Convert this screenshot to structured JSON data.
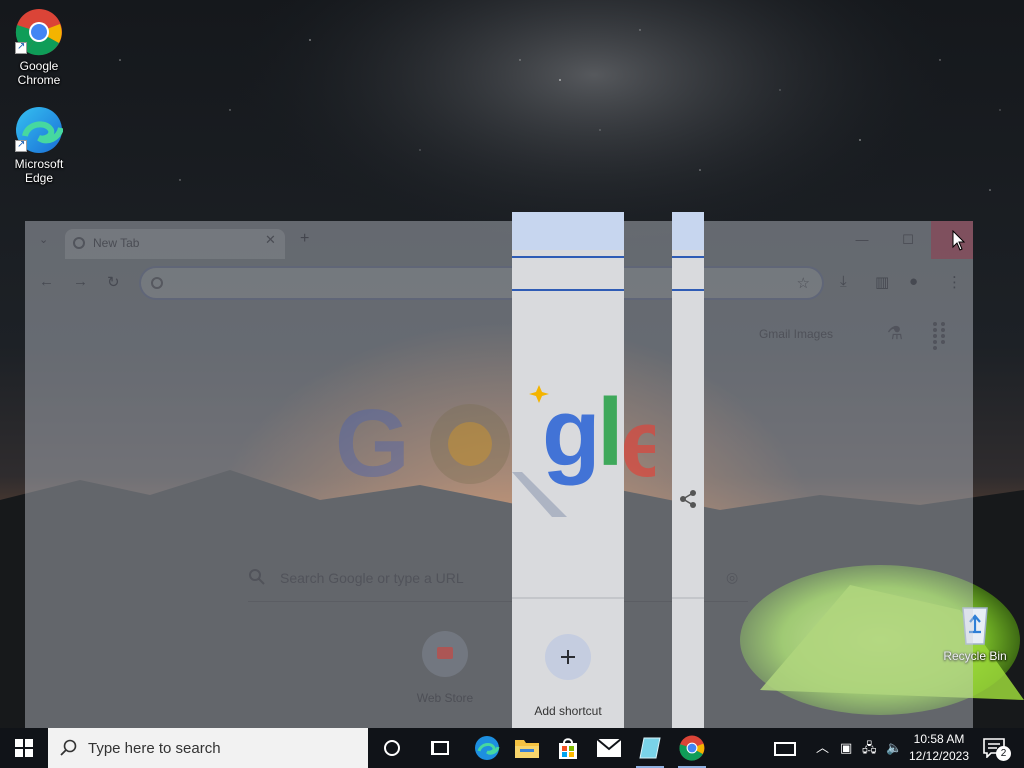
{
  "desktop": {
    "icons": [
      {
        "label_line1": "Google",
        "label_line2": "Chrome",
        "icon": "chrome-icon"
      },
      {
        "label_line1": "Microsoft",
        "label_line2": "Edge",
        "icon": "edge-icon"
      },
      {
        "label": "Recycle Bin",
        "icon": "recycle-bin-icon"
      }
    ]
  },
  "chrome": {
    "tab_title": "New Tab",
    "tab_close": "✕",
    "new_tab": "+",
    "minimize": "—",
    "maximize": "☐",
    "ntp_links": "Gmail  Images",
    "search_placeholder": "Search Google or type a URL",
    "shortcuts": [
      {
        "label": "Web Store"
      },
      {
        "label": "Add shortcut"
      }
    ],
    "doodle_letters": [
      "G",
      "o",
      "o",
      "g",
      "l",
      "e"
    ]
  },
  "taskbar": {
    "search_placeholder": "Type here to search",
    "time": "10:58 AM",
    "date": "12/12/2023",
    "notification_count": "2",
    "apps": [
      "cortana-icon",
      "task-view-icon",
      "edge-icon",
      "file-explorer-icon",
      "store-icon",
      "mail-icon",
      "notepad-icon",
      "chrome-icon"
    ]
  },
  "colors": {
    "taskbar": "#101318",
    "chrome_frame": "#cdd2dc",
    "slice_bg": "#d9dadd",
    "accent_blue": "#2f5cb5"
  }
}
